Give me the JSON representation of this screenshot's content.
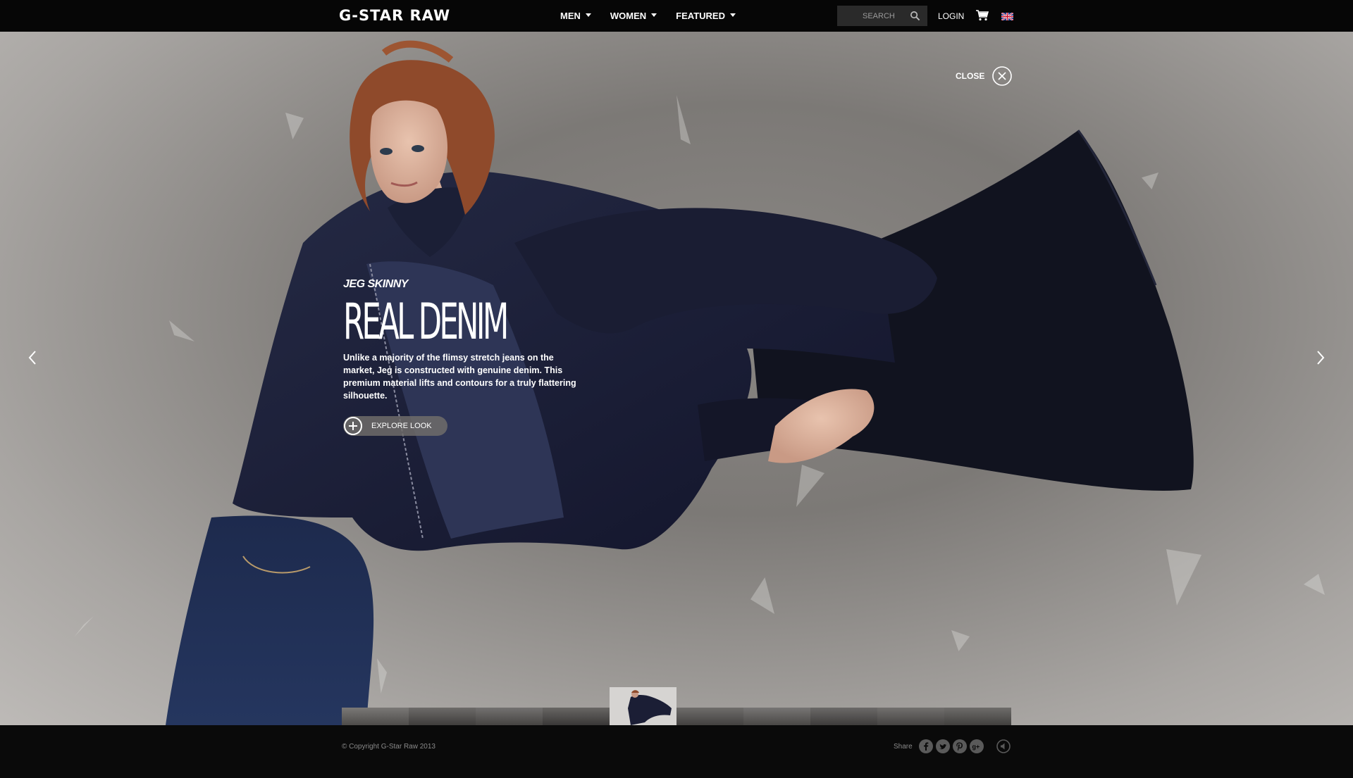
{
  "header": {
    "logo": "G-STAR RAW",
    "nav": [
      {
        "label": "MEN"
      },
      {
        "label": "WOMEN"
      },
      {
        "label": "FEATURED"
      }
    ],
    "search_placeholder": "SEARCH",
    "login": "LOGIN",
    "icons": [
      "search-icon",
      "cart-icon",
      "uk-flag-icon"
    ]
  },
  "hero": {
    "close_label": "CLOSE",
    "kicker": "JEG SKINNY",
    "headline": "REAL DENIM",
    "body": "Unlike a majority of the flimsy stretch jeans on the market, Jeg is constructed with genuine denim. This premium material lifts and contours for a truly flattering silhouette.",
    "explore_label": "EXPLORE LOOK",
    "icons": [
      "chevron-left-icon",
      "chevron-right-icon",
      "close-icon",
      "plus-icon"
    ]
  },
  "thumbnails": {
    "count": 10,
    "active_index": 4
  },
  "footer": {
    "copyright": "© Copyright G-Star Raw 2013",
    "share_label": "Share",
    "social": [
      "facebook-icon",
      "twitter-icon",
      "pinterest-icon",
      "google-plus-icon",
      "sound-icon"
    ]
  },
  "colors": {
    "topbar": "#060606",
    "footer": "#0a0a0a",
    "denim": "#1c1f36"
  }
}
